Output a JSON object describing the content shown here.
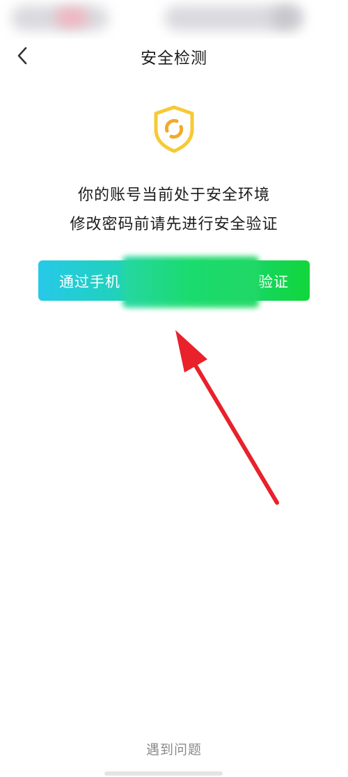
{
  "header": {
    "title": "安全检测",
    "back_icon": "chevron-left-icon"
  },
  "shield": {
    "icon": "shield-icon",
    "border_color": "#f7c934",
    "inner_color": "#f3a928"
  },
  "messages": {
    "line1": "你的账号当前处于安全环境",
    "line2": "修改密码前请先进行安全验证"
  },
  "verify_button": {
    "label_left": "通过手机",
    "label_right": "验证",
    "gradient_start": "#27c9e8",
    "gradient_end": "#12d63a",
    "text_color": "#ffffff"
  },
  "annotation": {
    "arrow_color": "#e8212b"
  },
  "footer": {
    "help_label": "遇到问题"
  }
}
